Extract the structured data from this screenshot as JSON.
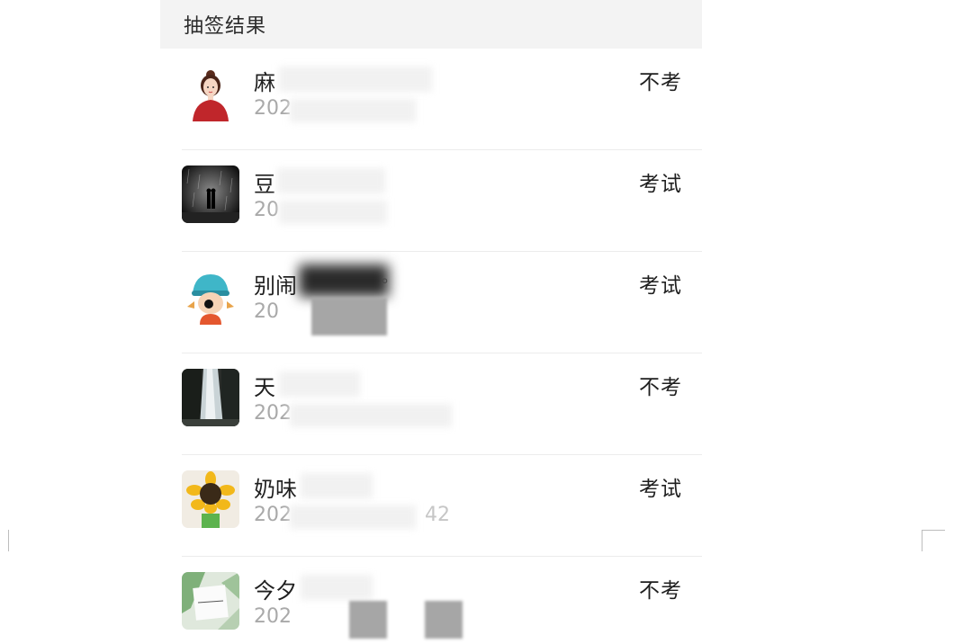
{
  "header": {
    "title": "抽签结果"
  },
  "rows": [
    {
      "name": "麻",
      "date": "202",
      "result": "不考"
    },
    {
      "name": "豆",
      "date": "20",
      "result": "考试"
    },
    {
      "name": "别闹",
      "name_suffix": "。",
      "date": "20",
      "result": "考试"
    },
    {
      "name": "天",
      "date": "202",
      "result": "不考"
    },
    {
      "name": "奶味",
      "date": "202",
      "date_tail": "42",
      "result": "考试"
    },
    {
      "name": "今夕",
      "date": "202",
      "result": "不考"
    }
  ],
  "avatars": [
    "girl-red-sweater-icon",
    "rain-couple-photo",
    "girl-blue-hat-icon",
    "waterfall-photo",
    "sunflower-kid-icon",
    "card-on-leaves-photo"
  ]
}
